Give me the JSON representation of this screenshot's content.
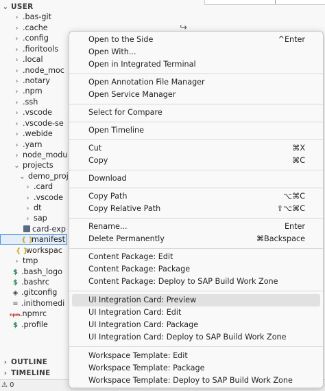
{
  "explorer": {
    "root_label": "USER",
    "items": [
      {
        "label": ".bas-git",
        "icon": "chevron-right-icon"
      },
      {
        "label": ".cache",
        "icon": "chevron-right-icon"
      },
      {
        "label": ".config",
        "icon": "chevron-right-icon"
      },
      {
        "label": ".fioritools",
        "icon": "chevron-right-icon"
      },
      {
        "label": ".local",
        "icon": "chevron-right-icon"
      },
      {
        "label": ".node_moc",
        "icon": "chevron-right-icon"
      },
      {
        "label": ".notary",
        "icon": "chevron-right-icon"
      },
      {
        "label": ".npm",
        "icon": "chevron-right-icon"
      },
      {
        "label": ".ssh",
        "icon": "chevron-right-icon"
      },
      {
        "label": ".vscode",
        "icon": "chevron-right-icon"
      },
      {
        "label": ".vscode-se",
        "icon": "chevron-right-icon"
      },
      {
        "label": ".webide",
        "icon": "chevron-right-icon"
      },
      {
        "label": ".yarn",
        "icon": "chevron-right-icon"
      },
      {
        "label": "node_modu",
        "icon": "chevron-right-icon"
      },
      {
        "label": "projects",
        "icon": "chevron-down-icon"
      },
      {
        "label": "demo_proj",
        "icon": "chevron-down-icon"
      },
      {
        "label": ".card",
        "icon": "chevron-right-icon"
      },
      {
        "label": ".vscode",
        "icon": "chevron-right-icon"
      },
      {
        "label": "dt",
        "icon": "chevron-right-icon"
      },
      {
        "label": "sap",
        "icon": "chevron-right-icon"
      },
      {
        "label": "card-exp",
        "icon": "card-file-icon"
      },
      {
        "label": "manifest",
        "icon": "json-file-icon"
      },
      {
        "label": "workspac",
        "icon": "json-file-icon"
      },
      {
        "label": "tmp",
        "icon": "chevron-right-icon"
      },
      {
        "label": ".bash_logo",
        "icon": "dollar-file-icon"
      },
      {
        "label": ".bashrc",
        "icon": "dollar-file-icon"
      },
      {
        "label": ".gitconfig",
        "icon": "git-file-icon"
      },
      {
        "label": ".inithomedi",
        "icon": "file-icon"
      },
      {
        "label": ".npmrc",
        "icon": "npm-file-icon"
      },
      {
        "label": ".profile",
        "icon": "dollar-file-icon"
      }
    ],
    "outline_label": "OUTLINE",
    "timeline_label": "TIMELINE"
  },
  "statusbar": {
    "warnings": "0"
  },
  "context_menu": {
    "items": [
      {
        "label": "Open to the Side",
        "shortcut": "^Enter"
      },
      {
        "label": "Open With...",
        "shortcut": ""
      },
      {
        "label": "Open in Integrated Terminal",
        "shortcut": ""
      },
      {
        "label": "Open Annotation File Manager",
        "shortcut": ""
      },
      {
        "label": "Open Service Manager",
        "shortcut": ""
      },
      {
        "label": "Select for Compare",
        "shortcut": ""
      },
      {
        "label": "Open Timeline",
        "shortcut": ""
      },
      {
        "label": "Cut",
        "shortcut": "⌘X"
      },
      {
        "label": "Copy",
        "shortcut": "⌘C"
      },
      {
        "label": "Download",
        "shortcut": ""
      },
      {
        "label": "Copy Path",
        "shortcut": "⌥⌘C"
      },
      {
        "label": "Copy Relative Path",
        "shortcut": "⇧⌥⌘C"
      },
      {
        "label": "Rename...",
        "shortcut": "Enter"
      },
      {
        "label": "Delete Permanently",
        "shortcut": "⌘Backspace"
      },
      {
        "label": "Content Package: Edit",
        "shortcut": ""
      },
      {
        "label": "Content Package: Package",
        "shortcut": ""
      },
      {
        "label": "Content Package: Deploy to SAP Build Work Zone",
        "shortcut": ""
      },
      {
        "label": "UI Integration Card: Preview",
        "shortcut": ""
      },
      {
        "label": "UI Integration Card: Edit",
        "shortcut": ""
      },
      {
        "label": "UI Integration Card: Package",
        "shortcut": ""
      },
      {
        "label": "UI Integration Card: Deploy to SAP Build Work Zone",
        "shortcut": ""
      },
      {
        "label": "Workspace Template: Edit",
        "shortcut": ""
      },
      {
        "label": "Workspace Template: Package",
        "shortcut": ""
      },
      {
        "label": "Workspace Template: Deploy to SAP Build Work Zone",
        "shortcut": ""
      }
    ]
  }
}
